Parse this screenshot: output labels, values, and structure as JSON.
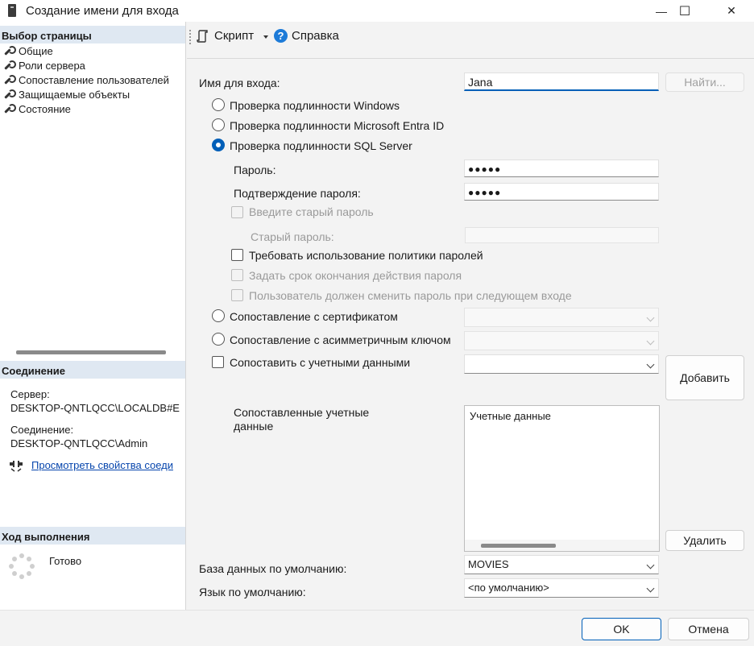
{
  "window": {
    "title": "Создание имени для входа",
    "minimize_glyph": "—",
    "maximize_glyph": "☐",
    "close_glyph": "✕"
  },
  "left_panel": {
    "select_page_header": "Выбор страницы",
    "pages": [
      {
        "label": "Общие"
      },
      {
        "label": "Роли сервера"
      },
      {
        "label": "Сопоставление пользователей"
      },
      {
        "label": "Защищаемые объекты"
      },
      {
        "label": "Состояние"
      }
    ],
    "connection_header": "Соединение",
    "server_label": "Сервер:",
    "server_value": "DESKTOP-QNTLQCC\\LOCALDB#E",
    "connection_label": "Соединение:",
    "connection_value": "DESKTOP-QNTLQCC\\Admin",
    "view_properties_link": "Просмотреть свойства соеди",
    "progress_header": "Ход выполнения",
    "progress_status": "Готово"
  },
  "toolbar": {
    "script_label": "Скрипт",
    "help_label": "Справка"
  },
  "form": {
    "login_name_label": "Имя для входа:",
    "login_name_value": "Jana",
    "search_button": "Найти...",
    "auth_windows": "Проверка подлинности Windows",
    "auth_entra": "Проверка подлинности Microsoft Entra ID",
    "auth_sql": "Проверка подлинности SQL Server",
    "password_label": "Пароль:",
    "password_value": "●●●●●",
    "confirm_password_label": "Подтверждение пароля:",
    "confirm_password_value": "●●●●●",
    "old_password_check": "Введите старый пароль",
    "old_password_label": "Старый пароль:",
    "enforce_policy": "Требовать использование политики паролей",
    "enforce_expiration": "Задать срок окончания действия пароля",
    "must_change": "Пользователь должен сменить пароль при следующем входе",
    "map_certificate": "Сопоставление с сертификатом",
    "map_asymmetric_key": "Сопоставление с асимметричным ключом",
    "map_credential": "Сопоставить с учетными данными",
    "add_button": "Добавить",
    "mapped_credentials_label": "Сопоставленные учетные данные",
    "credentials_column": "Учетные данные",
    "remove_button": "Удалить",
    "default_database_label": "База данных по умолчанию:",
    "default_database_value": "MOVIES",
    "default_language_label": "Язык по умолчанию:",
    "default_language_value": "<по умолчанию>"
  },
  "footer": {
    "ok_button": "OK",
    "cancel_button": "Отмена"
  },
  "colors": {
    "accent": "#005fb8",
    "link": "#0645ad",
    "section_header_bg": "#dfe8f2"
  }
}
